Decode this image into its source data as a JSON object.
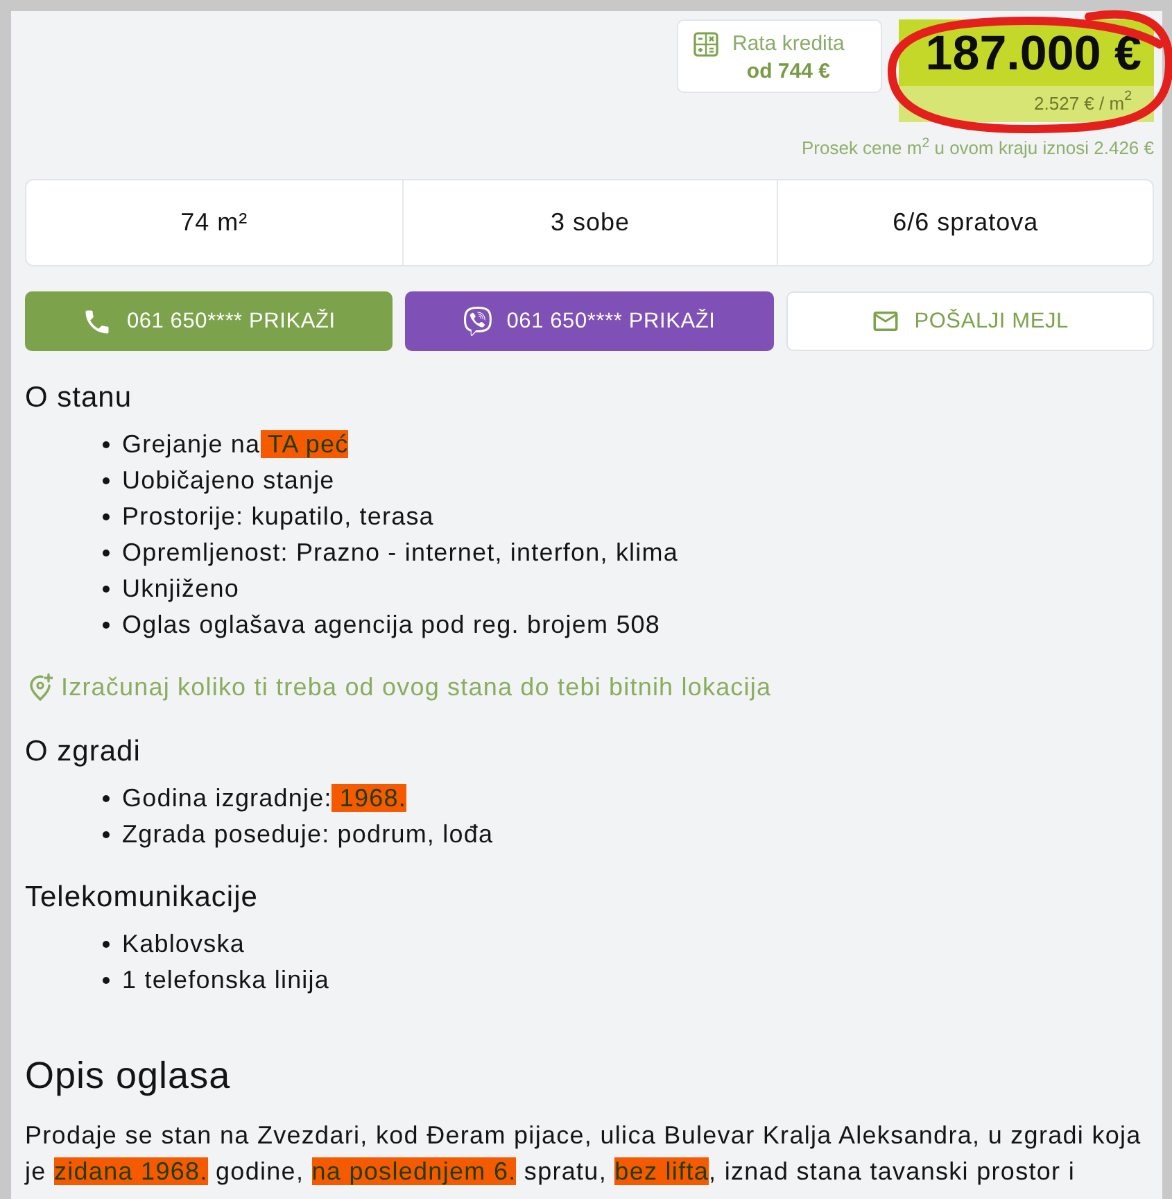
{
  "loan_rate": {
    "label": "Rata kredita",
    "value": "od 744 €"
  },
  "price": {
    "total": "187.000 €",
    "per_m2": "2.527 € / m$^{2}$"
  },
  "average_note": "Prosek cene m$^{2}$ u ovom kraju iznosi 2.426 €",
  "stats": [
    "74 m²",
    "3 sobe",
    "6/6 spratova"
  ],
  "actions": [
    {
      "kind": "phone",
      "label": "061 650**** PRIKAŽI"
    },
    {
      "kind": "viber",
      "label": "061 650**** PRIKAŽI"
    },
    {
      "kind": "email",
      "label": "POŠALJI MEJL"
    }
  ],
  "sections": [
    {
      "title": "O stanu",
      "items": [
        {
          "parts": [
            {
              "text": "Grejanje na",
              "highlighted": false
            },
            {
              "text": " TA peć",
              "highlighted": true
            }
          ]
        },
        {
          "parts": [
            {
              "text": "Uobičajeno stanje",
              "highlighted": false
            }
          ]
        },
        {
          "parts": [
            {
              "text": "Prostorije: kupatilo, terasa",
              "highlighted": false
            }
          ]
        },
        {
          "parts": [
            {
              "text": "Opremljenost: Prazno - internet, interfon, klima",
              "highlighted": false
            }
          ]
        },
        {
          "parts": [
            {
              "text": "Uknjiženo",
              "highlighted": false
            }
          ]
        },
        {
          "parts": [
            {
              "text": "Oglas oglašava agencija pod reg. brojem 508",
              "highlighted": false
            }
          ]
        }
      ],
      "link": "Izračunaj koliko ti treba od ovog stana do tebi bitnih lokacija"
    },
    {
      "title": "O zgradi",
      "items": [
        {
          "parts": [
            {
              "text": "Godina izgradnje:",
              "highlighted": false
            },
            {
              "text": " 1968.",
              "highlighted": true
            }
          ]
        },
        {
          "parts": [
            {
              "text": "Zgrada poseduje: podrum, lođa",
              "highlighted": false
            }
          ]
        }
      ]
    },
    {
      "title": "Telekomunikacije",
      "items": [
        {
          "parts": [
            {
              "text": "Kablovska",
              "highlighted": false
            }
          ]
        },
        {
          "parts": [
            {
              "text": "1 telefonska linija",
              "highlighted": false
            }
          ]
        }
      ]
    }
  ],
  "description": {
    "title": "Opis oglasa",
    "parts": [
      {
        "text": "Prodaje se stan na Zvezdari, kod Đeram pijace, ulica Bulevar Kralja Aleksandra, u zgradi koja je ",
        "highlighted": false
      },
      {
        "text": "zidana 1968.",
        "highlighted": true
      },
      {
        "text": " godine, ",
        "highlighted": false
      },
      {
        "text": "na poslednjem 6.",
        "highlighted": true
      },
      {
        "text": " spratu, ",
        "highlighted": false
      },
      {
        "text": "bez lifta",
        "highlighted": true
      },
      {
        "text": ", iznad stana tavanski prostor i",
        "highlighted": false
      }
    ]
  }
}
